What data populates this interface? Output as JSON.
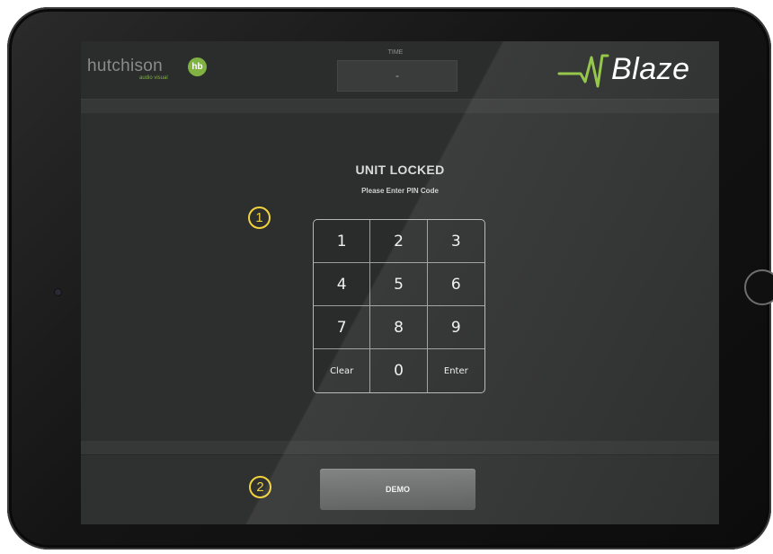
{
  "header": {
    "brand": {
      "name": "hutchison",
      "tagline": "audio visual",
      "badge": "hb"
    },
    "time": {
      "label": "TIME",
      "value": "-"
    },
    "logo": {
      "text": "Blaze"
    }
  },
  "lock_screen": {
    "title": "UNIT LOCKED",
    "subtitle": "Please Enter PIN Code",
    "keypad": [
      "1",
      "2",
      "3",
      "4",
      "5",
      "6",
      "7",
      "8",
      "9",
      "Clear",
      "0",
      "Enter"
    ]
  },
  "footer": {
    "demo_label": "DEMO"
  },
  "callouts": [
    "1",
    "2"
  ],
  "colors": {
    "accent_green": "#7fb241",
    "callout_yellow": "#f1d33d",
    "screen_bg": "#2d2e2e"
  }
}
